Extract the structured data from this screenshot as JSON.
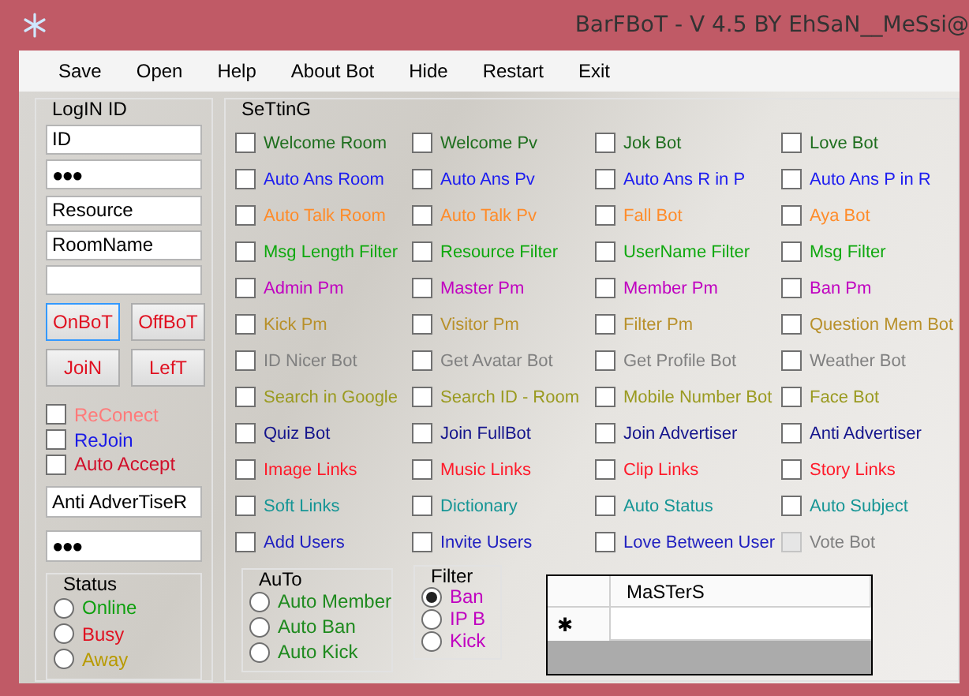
{
  "window": {
    "title": "BarFBoT - V 4.5 BY EhSaN__MeSsi@"
  },
  "menu": [
    "Save",
    "Open",
    "Help",
    "About Bot",
    "Hide",
    "Restart",
    "Exit"
  ],
  "login": {
    "title": "LogIN ID",
    "fields": [
      {
        "kind": "text",
        "value": "ID"
      },
      {
        "kind": "password",
        "value": "●●●"
      },
      {
        "kind": "text",
        "value": "Resource"
      },
      {
        "kind": "text",
        "value": "RoomName"
      },
      {
        "kind": "text"
      }
    ],
    "buttons": [
      {
        "label": "OnBoT",
        "focused": true
      },
      {
        "label": "OffBoT",
        "focused": false
      },
      {
        "label": "JoiN",
        "focused": false
      },
      {
        "label": "LefT",
        "focused": false
      }
    ],
    "options": [
      {
        "label": "ReConect",
        "checked": false,
        "color": "#ff7a7a"
      },
      {
        "label": "ReJoin",
        "checked": false,
        "color": "#1a1ae6"
      },
      {
        "label": "Auto Accept",
        "checked": false,
        "color": "#d0102a"
      }
    ],
    "advertiser_fields": [
      {
        "kind": "text",
        "value": "Anti AdverTiseR"
      },
      {
        "kind": "password",
        "value": "●●●"
      }
    ],
    "status": {
      "title": "Status",
      "options": [
        {
          "label": "Online",
          "selected": false,
          "color": "#0fa00f"
        },
        {
          "label": "Busy",
          "selected": false,
          "color": "#e01020"
        },
        {
          "label": "Away",
          "selected": false,
          "color": "#b89a00"
        }
      ]
    }
  },
  "setting": {
    "title": "SeTtinG",
    "items": [
      {
        "label": "Welcome Room",
        "checked": false,
        "disabled": false,
        "color": "#1e6e1e"
      },
      {
        "label": "Welcome Pv",
        "checked": false,
        "disabled": false,
        "color": "#1e6e1e"
      },
      {
        "label": "Jok Bot",
        "checked": false,
        "disabled": false,
        "color": "#1e6e1e"
      },
      {
        "label": "Love Bot",
        "checked": false,
        "disabled": false,
        "color": "#1e6e1e"
      },
      {
        "label": "Auto Ans Room",
        "checked": false,
        "disabled": false,
        "color": "#1c1cf0"
      },
      {
        "label": "Auto Ans Pv",
        "checked": false,
        "disabled": false,
        "color": "#1c1cf0"
      },
      {
        "label": "Auto Ans R in P",
        "checked": false,
        "disabled": false,
        "color": "#1c1cf0"
      },
      {
        "label": "Auto Ans P in R",
        "checked": false,
        "disabled": false,
        "color": "#1c1cf0"
      },
      {
        "label": "Auto Talk Room",
        "checked": false,
        "disabled": false,
        "color": "#ff8c2a"
      },
      {
        "label": "Auto Talk Pv",
        "checked": false,
        "disabled": false,
        "color": "#ff8c2a"
      },
      {
        "label": "Fall Bot",
        "checked": false,
        "disabled": false,
        "color": "#ff8c2a"
      },
      {
        "label": "Aya Bot",
        "checked": false,
        "disabled": false,
        "color": "#ff8c2a"
      },
      {
        "label": "Msg Length Filter",
        "checked": false,
        "disabled": false,
        "color": "#0fa80f"
      },
      {
        "label": "Resource Filter",
        "checked": false,
        "disabled": false,
        "color": "#0fa80f"
      },
      {
        "label": "UserName Filter",
        "checked": false,
        "disabled": false,
        "color": "#0fa80f"
      },
      {
        "label": "Msg Filter",
        "checked": false,
        "disabled": false,
        "color": "#0fa80f"
      },
      {
        "label": "Admin Pm",
        "checked": false,
        "disabled": false,
        "color": "#c000c0"
      },
      {
        "label": "Master Pm",
        "checked": false,
        "disabled": false,
        "color": "#c000c0"
      },
      {
        "label": "Member Pm",
        "checked": false,
        "disabled": false,
        "color": "#c000c0"
      },
      {
        "label": "Ban Pm",
        "checked": false,
        "disabled": false,
        "color": "#c000c0"
      },
      {
        "label": "Kick Pm",
        "checked": false,
        "disabled": false,
        "color": "#b8902a"
      },
      {
        "label": "Visitor Pm",
        "checked": false,
        "disabled": false,
        "color": "#b8902a"
      },
      {
        "label": "Filter Pm",
        "checked": false,
        "disabled": false,
        "color": "#b8902a"
      },
      {
        "label": "Question Mem Bot",
        "checked": false,
        "disabled": false,
        "color": "#b8902a"
      },
      {
        "label": "ID Nicer Bot",
        "checked": false,
        "disabled": false,
        "color": "#808080"
      },
      {
        "label": "Get Avatar Bot",
        "checked": false,
        "disabled": false,
        "color": "#808080"
      },
      {
        "label": "Get Profile Bot",
        "checked": false,
        "disabled": false,
        "color": "#808080"
      },
      {
        "label": "Weather Bot",
        "checked": false,
        "disabled": false,
        "color": "#808080"
      },
      {
        "label": "Search in Google",
        "checked": false,
        "disabled": false,
        "color": "#9a9a20"
      },
      {
        "label": "Search ID - Room",
        "checked": false,
        "disabled": false,
        "color": "#9a9a20"
      },
      {
        "label": "Mobile Number Bot",
        "checked": false,
        "disabled": false,
        "color": "#9a9a20"
      },
      {
        "label": "Face Bot",
        "checked": false,
        "disabled": false,
        "color": "#9a9a20"
      },
      {
        "label": "Quiz Bot",
        "checked": false,
        "disabled": false,
        "color": "#14148c"
      },
      {
        "label": "Join FullBot",
        "checked": false,
        "disabled": false,
        "color": "#14148c"
      },
      {
        "label": "Join Advertiser",
        "checked": false,
        "disabled": false,
        "color": "#14148c"
      },
      {
        "label": "Anti Advertiser",
        "checked": false,
        "disabled": false,
        "color": "#14148c"
      },
      {
        "label": "Image Links",
        "checked": false,
        "disabled": false,
        "color": "#ff1a2a"
      },
      {
        "label": "Music Links",
        "checked": false,
        "disabled": false,
        "color": "#ff1a2a"
      },
      {
        "label": "Clip Links",
        "checked": false,
        "disabled": false,
        "color": "#ff1a2a"
      },
      {
        "label": "Story Links",
        "checked": false,
        "disabled": false,
        "color": "#ff1a2a"
      },
      {
        "label": "Soft Links",
        "checked": false,
        "disabled": false,
        "color": "#159595"
      },
      {
        "label": "Dictionary",
        "checked": false,
        "disabled": false,
        "color": "#159595"
      },
      {
        "label": "Auto Status",
        "checked": false,
        "disabled": false,
        "color": "#159595"
      },
      {
        "label": "Auto Subject",
        "checked": false,
        "disabled": false,
        "color": "#159595"
      },
      {
        "label": "Add Users",
        "checked": false,
        "disabled": false,
        "color": "#2020c0"
      },
      {
        "label": "Invite Users",
        "checked": false,
        "disabled": false,
        "color": "#2020c0"
      },
      {
        "label": "Love Between User",
        "checked": false,
        "disabled": false,
        "color": "#2020c0"
      },
      {
        "label": "Vote Bot",
        "checked": false,
        "disabled": true,
        "color": "#808080"
      }
    ],
    "auto": {
      "title": "AuTo",
      "options": [
        {
          "label": "Auto Member",
          "selected": false
        },
        {
          "label": "Auto Ban",
          "selected": false
        },
        {
          "label": "Auto Kick",
          "selected": false
        }
      ]
    },
    "filter": {
      "title": "Filter",
      "options": [
        {
          "label": "Ban",
          "selected": true
        },
        {
          "label": "IP B",
          "selected": false
        },
        {
          "label": "Kick",
          "selected": false
        }
      ]
    },
    "grid": {
      "columns": [
        "MaSTerS"
      ],
      "new_row_marker": "✱"
    }
  }
}
